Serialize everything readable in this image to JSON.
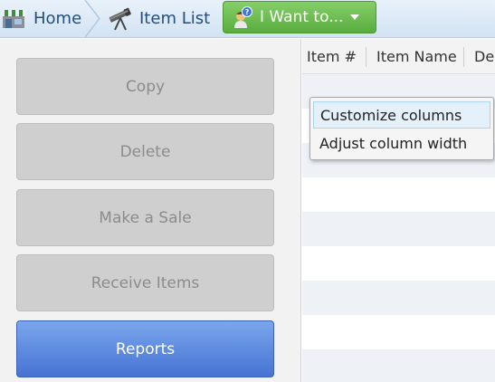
{
  "nav": {
    "home_label": "Home",
    "item_list_label": "Item List",
    "i_want_to_label": "I Want to..."
  },
  "actions": [
    {
      "label": "Copy",
      "state": "disabled"
    },
    {
      "label": "Delete",
      "state": "disabled"
    },
    {
      "label": "Make a Sale",
      "state": "disabled"
    },
    {
      "label": "Receive Items",
      "state": "disabled"
    },
    {
      "label": "Reports",
      "state": "active"
    }
  ],
  "grid": {
    "columns": [
      "Item #",
      "Item Name",
      "De"
    ]
  },
  "context_menu": {
    "items": [
      "Customize columns",
      "Adjust column width"
    ]
  },
  "colors": {
    "nav_text": "#1f4f80",
    "i_want_to_green": "#58ac3e",
    "active_button_blue": "#4673d4",
    "disabled_button": "#cfcfcf"
  },
  "icons": {
    "home": "store-icon",
    "item_list": "telescope-icon",
    "i_want_to": "person-help-icon",
    "dropdown": "caret-down-icon"
  }
}
